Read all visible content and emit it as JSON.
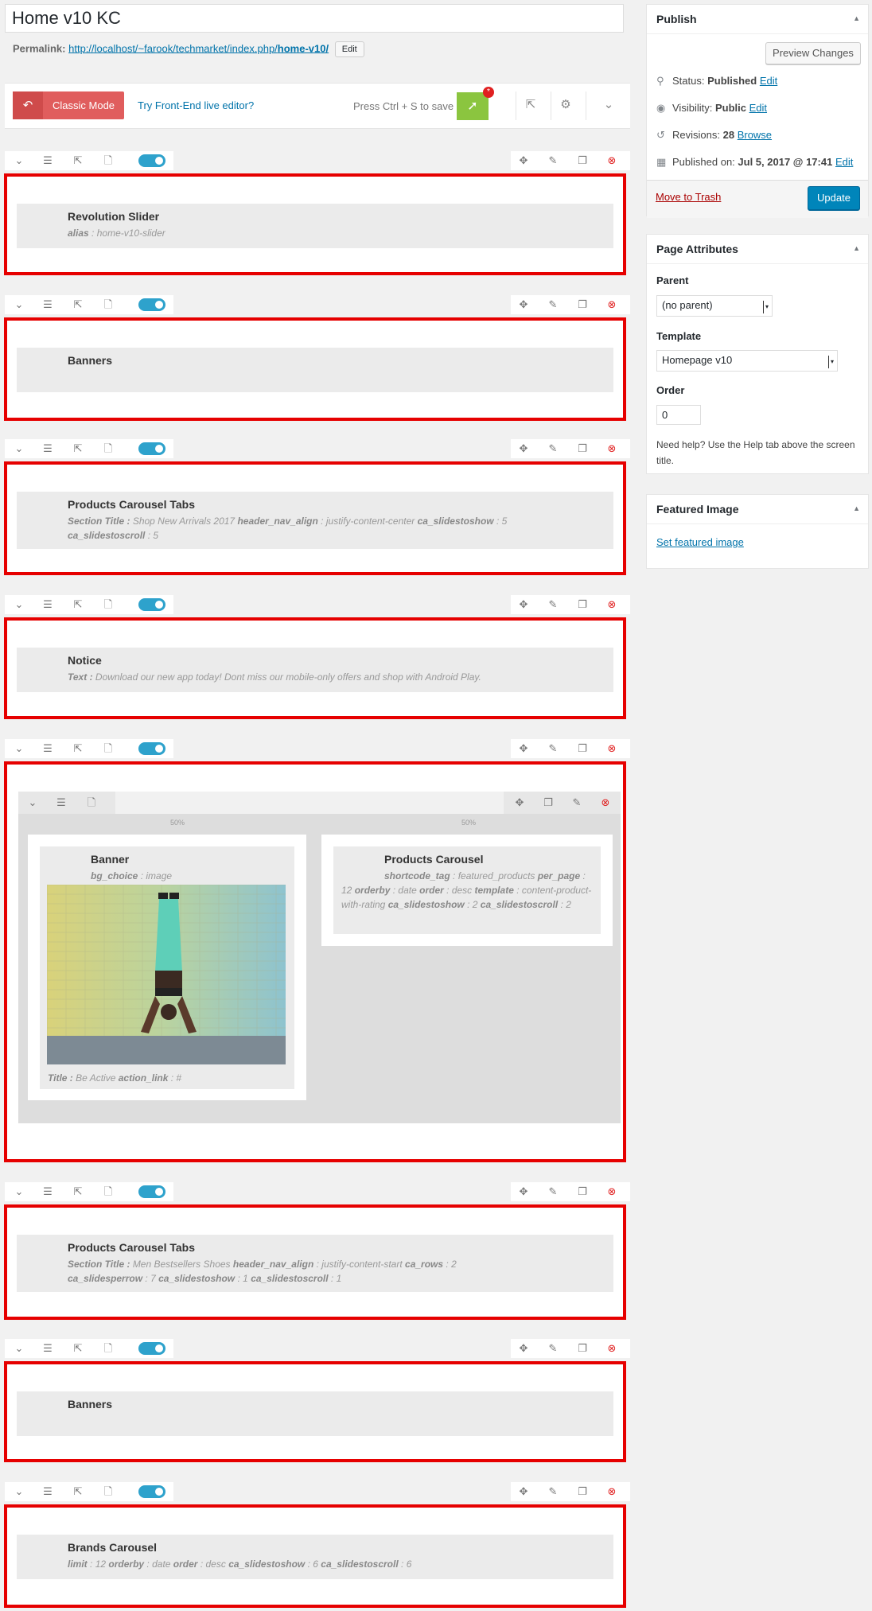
{
  "title": "Home v10 KC",
  "permalink": {
    "label": "Permalink:",
    "url_base": "http://localhost/~farook/techmarket/index.php/",
    "slug": "home-v10/",
    "edit_label": "Edit"
  },
  "kc_toolbar": {
    "classic_label": "Classic Mode",
    "live_link": "Try Front-End live editor?",
    "save_hint": "Press Ctrl + S to save",
    "badge": "*"
  },
  "elements": {
    "revolution": {
      "title": "Revolution Slider",
      "desc": [
        {
          "k": "alias",
          "v": "home-v10-slider"
        }
      ]
    },
    "banners1": {
      "title": "Banners"
    },
    "pct1": {
      "title": "Products Carousel Tabs",
      "desc": [
        {
          "k": "Section Title",
          "v": "Shop New Arrivals 2017"
        },
        {
          "k": "header_nav_align",
          "v": "justify-content-center"
        },
        {
          "k": "ca_slidestoshow",
          "v": "5"
        },
        {
          "k": "ca_slidestoscroll",
          "v": "5"
        }
      ]
    },
    "notice": {
      "title": "Notice",
      "desc": [
        {
          "k": "Text",
          "v": "Download our new app today! Dont miss our mobile-only offers and shop with Android Play."
        }
      ]
    },
    "nested": {
      "col1_pct": "50%",
      "col2_pct": "50%",
      "banner": {
        "title": "Banner",
        "desc_top": [
          {
            "k": "bg_choice",
            "v": "image"
          }
        ],
        "desc_bottom": [
          {
            "k": "Title",
            "v": "Be Active"
          },
          {
            "k": "action_link",
            "v": "#"
          }
        ]
      },
      "carousel": {
        "title": "Products Carousel",
        "desc": [
          {
            "k": "shortcode_tag",
            "v": "featured_products"
          },
          {
            "k": "per_page",
            "v": "12"
          },
          {
            "k": "orderby",
            "v": "date"
          },
          {
            "k": "order",
            "v": "desc"
          },
          {
            "k": "template",
            "v": "content-product-with-rating"
          },
          {
            "k": "ca_slidestoshow",
            "v": "2"
          },
          {
            "k": "ca_slidestoscroll",
            "v": "2"
          }
        ]
      }
    },
    "pct2": {
      "title": "Products Carousel Tabs",
      "desc": [
        {
          "k": "Section Title",
          "v": "Men Bestsellers Shoes"
        },
        {
          "k": "header_nav_align",
          "v": "justify-content-start"
        },
        {
          "k": "ca_rows",
          "v": "2"
        },
        {
          "k": "ca_slidesperrow",
          "v": "7"
        },
        {
          "k": "ca_slidestoshow",
          "v": "1"
        },
        {
          "k": "ca_slidestoscroll",
          "v": "1"
        }
      ]
    },
    "banners2": {
      "title": "Banners"
    },
    "brands": {
      "title": "Brands Carousel",
      "desc": [
        {
          "k": "limit",
          "v": "12"
        },
        {
          "k": "orderby",
          "v": "date"
        },
        {
          "k": "order",
          "v": "desc"
        },
        {
          "k": "ca_slidestoshow",
          "v": "6"
        },
        {
          "k": "ca_slidestoscroll",
          "v": "6"
        }
      ]
    }
  },
  "publish": {
    "title": "Publish",
    "preview_label": "Preview Changes",
    "status_label": "Status:",
    "status_value": "Published",
    "visibility_label": "Visibility:",
    "visibility_value": "Public",
    "revisions_label": "Revisions:",
    "revisions_value": "28",
    "browse_label": "Browse",
    "published_label": "Published on:",
    "published_value": "Jul 5, 2017 @ 17:41",
    "edit_label": "Edit",
    "trash_label": "Move to Trash",
    "update_label": "Update"
  },
  "page_attributes": {
    "title": "Page Attributes",
    "parent_label": "Parent",
    "parent_value": "(no parent)",
    "template_label": "Template",
    "template_value": "Homepage v10",
    "order_label": "Order",
    "order_value": "0",
    "help_text": "Need help? Use the Help tab above the screen title."
  },
  "featured_image": {
    "title": "Featured Image",
    "link_label": "Set featured image"
  },
  "colors": {
    "accent_red": "#e60000",
    "kc_red": "#e05d5d",
    "rocket_green": "#8bc53f",
    "wp_blue": "#0085ba",
    "toggle_blue": "#2ea2cc"
  }
}
